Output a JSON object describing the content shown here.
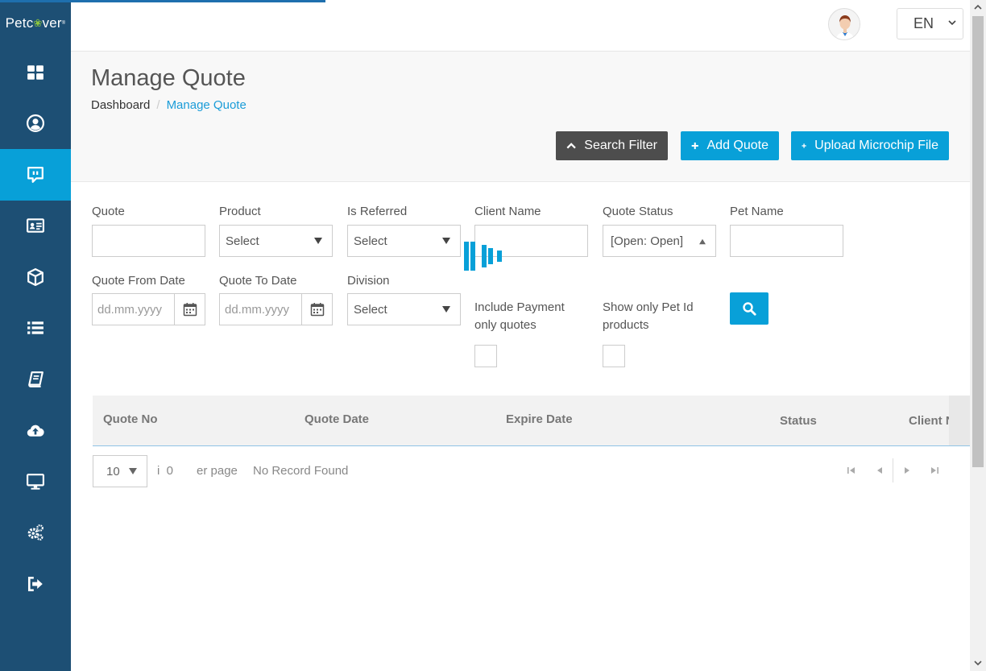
{
  "loading": {
    "progress": 0.33
  },
  "logo": {
    "text_pre": "Petc",
    "paw": "❀",
    "text_post": "ver",
    "mark": "®"
  },
  "sidebar": {
    "items": [
      {
        "name": "dashboard-icon",
        "active": false
      },
      {
        "name": "user-circle-icon",
        "active": false
      },
      {
        "name": "chat-quote-icon",
        "active": true
      },
      {
        "name": "id-card-icon",
        "active": false
      },
      {
        "name": "box-icon",
        "active": false
      },
      {
        "name": "list-icon",
        "active": false
      },
      {
        "name": "book-icon",
        "active": false
      },
      {
        "name": "cloud-upload-icon",
        "active": false
      },
      {
        "name": "monitor-icon",
        "active": false
      },
      {
        "name": "cogs-icon",
        "active": false
      },
      {
        "name": "sign-out-icon",
        "active": false
      }
    ]
  },
  "header": {
    "language": "EN"
  },
  "page": {
    "title": "Manage Quote",
    "breadcrumb": {
      "home": "Dashboard",
      "separator": "/",
      "current": "Manage Quote"
    }
  },
  "actions": {
    "search_filter": "Search Filter",
    "add_quote": "Add Quote",
    "upload_microchip": "Upload Microchip File"
  },
  "filters": {
    "quote": {
      "label": "Quote",
      "value": ""
    },
    "product": {
      "label": "Product",
      "value": "Select"
    },
    "is_referred": {
      "label": "Is Referred",
      "value": "Select"
    },
    "client_name": {
      "label": "Client Name",
      "value": ""
    },
    "quote_status": {
      "label": "Quote Status",
      "value": "[Open: Open]"
    },
    "pet_name": {
      "label": "Pet Name",
      "value": ""
    },
    "quote_from_date": {
      "label": "Quote From Date",
      "placeholder": "dd.mm.yyyy"
    },
    "quote_to_date": {
      "label": "Quote To Date",
      "placeholder": "dd.mm.yyyy"
    },
    "division": {
      "label": "Division",
      "value": "Select"
    },
    "include_payment": {
      "label_line1": "Include Payment",
      "label_line2": "only quotes",
      "checked": false
    },
    "show_pet_id": {
      "label_line1": "Show only Pet Id",
      "label_line2": "products",
      "checked": false
    }
  },
  "table": {
    "columns": [
      "Quote No",
      "Quote Date",
      "Expire Date",
      "Status",
      "Client Nam"
    ]
  },
  "pager": {
    "page_size": "10",
    "info_fragment": "i  0",
    "per_page": "er page",
    "no_record": "No Record Found"
  },
  "colors": {
    "sidebar": "#1d4f74",
    "accent": "#08a0d8",
    "dark_button": "#4d4d4d"
  }
}
